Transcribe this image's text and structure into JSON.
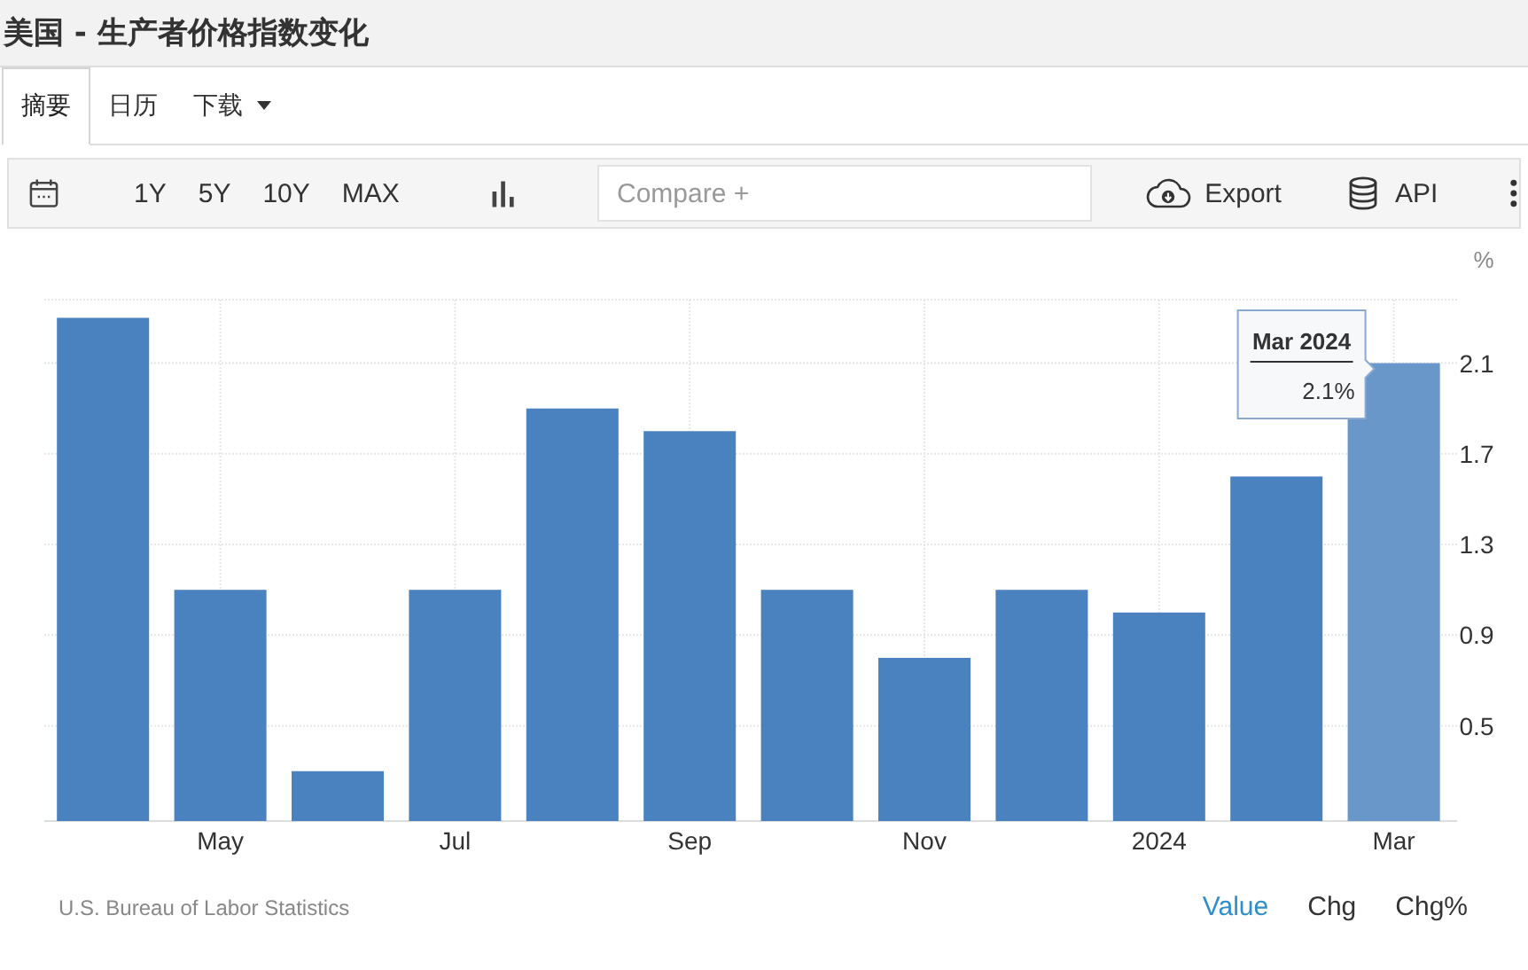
{
  "title": "美国 - 生产者价格指数变化",
  "tabs": [
    {
      "label": "摘要",
      "selected": true
    },
    {
      "label": "日历",
      "selected": false
    },
    {
      "label": "下载",
      "selected": false,
      "dropdown": true
    }
  ],
  "toolbar": {
    "ranges": [
      {
        "label": "1Y",
        "selected": false
      },
      {
        "label": "5Y",
        "selected": false
      },
      {
        "label": "10Y",
        "selected": false
      },
      {
        "label": "MAX",
        "selected": false
      }
    ],
    "compare_placeholder": "Compare +",
    "export": "Export",
    "api": "API"
  },
  "chart": {
    "unit": "%",
    "chart_data": {
      "type": "bar",
      "categories": [
        null,
        "May",
        null,
        "Jul",
        null,
        "Sep",
        null,
        "Nov",
        null,
        "2024",
        null,
        "Mar"
      ],
      "values": [
        2.3,
        1.1,
        0.3,
        1.1,
        1.9,
        1.8,
        1.1,
        0.8,
        1.1,
        1.0,
        1.6,
        2.1
      ],
      "color": "#4a81bf",
      "ylim": [
        0.08,
        2.38
      ],
      "grid": true,
      "yticks": [
        0.5,
        0.9,
        1.3,
        1.7,
        2.1
      ],
      "annotations": [
        "Mar 2024",
        "2.1%"
      ]
    }
  },
  "source": "U.S. Bureau of Labor Statistics",
  "views": [
    {
      "label": "Value",
      "selected": true
    },
    {
      "label": "Chg",
      "selected": false
    },
    {
      "label": "Chg%",
      "selected": false
    }
  ]
}
